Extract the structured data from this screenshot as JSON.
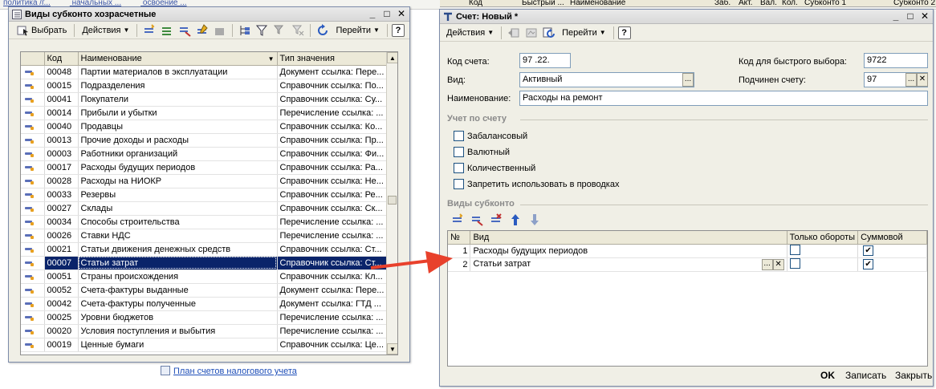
{
  "background": {
    "top_links": [
      "политика /г...",
      "начальных ...",
      "освоение ..."
    ],
    "bottom_link": "План счетов налогового учета",
    "top_right_header": [
      "Код",
      "Быстрый ...",
      "Наименование",
      "Заб.",
      "Акт.",
      "Вал.",
      "Кол.",
      "Субконто 1",
      "Субконто 2"
    ]
  },
  "left_window": {
    "title": "Виды субконто хозрасчетные",
    "toolbar": {
      "select": "Выбрать",
      "actions": "Действия",
      "goto": "Перейти",
      "help": "?"
    },
    "columns": [
      "Код",
      "Наименование",
      "Тип значения"
    ],
    "rows": [
      {
        "code": "00048",
        "name": "Партии материалов в эксплуатации",
        "type": "Документ ссылка: Пере..."
      },
      {
        "code": "00015",
        "name": "Подразделения",
        "type": "Справочник ссылка: По..."
      },
      {
        "code": "00041",
        "name": "Покупатели",
        "type": "Справочник ссылка: Су..."
      },
      {
        "code": "00014",
        "name": "Прибыли и убытки",
        "type": "Перечисление ссылка: ..."
      },
      {
        "code": "00040",
        "name": "Продавцы",
        "type": "Справочник ссылка: Ко..."
      },
      {
        "code": "00013",
        "name": "Прочие доходы и расходы",
        "type": "Справочник ссылка: Пр..."
      },
      {
        "code": "00003",
        "name": "Работники организаций",
        "type": "Справочник ссылка: Фи..."
      },
      {
        "code": "00017",
        "name": "Расходы будущих периодов",
        "type": "Справочник ссылка: Ра..."
      },
      {
        "code": "00028",
        "name": "Расходы на НИОКР",
        "type": "Справочник ссылка: Не..."
      },
      {
        "code": "00033",
        "name": "Резервы",
        "type": "Справочник ссылка: Ре..."
      },
      {
        "code": "00027",
        "name": "Склады",
        "type": "Справочник ссылка: Ск..."
      },
      {
        "code": "00034",
        "name": "Способы строительства",
        "type": "Перечисление ссылка: ..."
      },
      {
        "code": "00026",
        "name": "Ставки НДС",
        "type": "Перечисление ссылка: ..."
      },
      {
        "code": "00021",
        "name": "Статьи движения денежных средств",
        "type": "Справочник ссылка: Ст..."
      },
      {
        "code": "00007",
        "name": "Статьи затрат",
        "type": "Справочник ссылка: Ст...",
        "selected": true
      },
      {
        "code": "00051",
        "name": "Страны происхождения",
        "type": "Справочник ссылка: Кл..."
      },
      {
        "code": "00052",
        "name": "Счета-фактуры выданные",
        "type": "Документ ссылка: Пере..."
      },
      {
        "code": "00042",
        "name": "Счета-фактуры полученные",
        "type": "Документ ссылка: ГТД ..."
      },
      {
        "code": "00025",
        "name": "Уровни бюджетов",
        "type": "Перечисление ссылка: ..."
      },
      {
        "code": "00020",
        "name": "Условия поступления и выбытия",
        "type": "Перечисление ссылка: ..."
      },
      {
        "code": "00019",
        "name": "Ценные бумаги",
        "type": "Справочник ссылка: Це..."
      }
    ]
  },
  "right_window": {
    "title": "Счет: Новый *",
    "toolbar": {
      "actions": "Действия",
      "goto": "Перейти",
      "help": "?"
    },
    "fields": {
      "account_code_label": "Код счета:",
      "account_code_value": "97 .22.",
      "quick_code_label": "Код для быстрого выбора:",
      "quick_code_value": "9722",
      "kind_label": "Вид:",
      "kind_value": "Активный",
      "parent_label": "Подчинен счету:",
      "parent_value": "97",
      "name_label": "Наименование:",
      "name_value": "Расходы на ремонт"
    },
    "accounting_group": {
      "title": "Учет по счету",
      "checkboxes": [
        {
          "label": "Забалансовый",
          "checked": false
        },
        {
          "label": "Валютный",
          "checked": false
        },
        {
          "label": "Количественный",
          "checked": false
        },
        {
          "label": "Запретить использовать в проводках",
          "checked": false
        }
      ]
    },
    "subconto_group": {
      "title": "Виды субконто",
      "columns": [
        "№",
        "Вид",
        "Только обороты",
        "Суммовой"
      ],
      "rows": [
        {
          "num": "1",
          "kind": "Расходы будущих периодов",
          "turnover_only": false,
          "sum": true
        },
        {
          "num": "2",
          "kind": "Статьи затрат",
          "turnover_only": false,
          "sum": true
        }
      ]
    },
    "buttons": {
      "ok": "OK",
      "save": "Записать",
      "close": "Закрыть"
    }
  },
  "colors": {
    "selection": "#0a246a",
    "arrow": "#e8412c",
    "window_bg": "#f0efe6"
  }
}
